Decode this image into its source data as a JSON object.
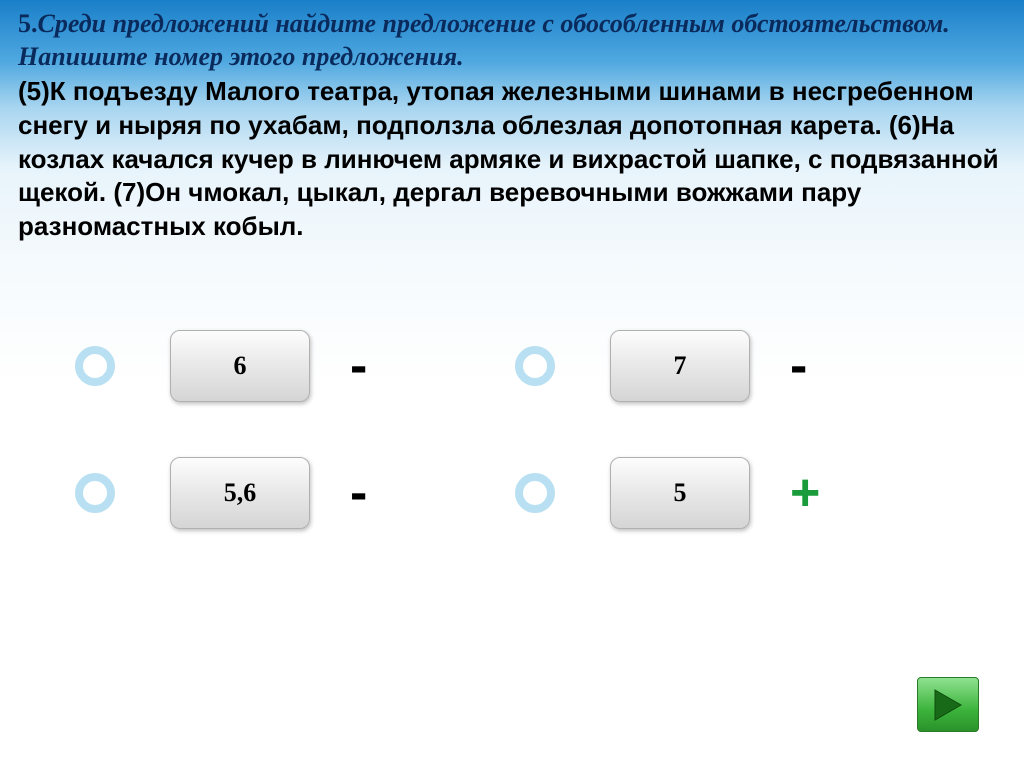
{
  "question": {
    "number": "5.",
    "prompt": "Среди предложений найдите предложение с обособленным обстоятельством. Напишите номер этого предложения.",
    "body": "(5)К подъезду Малого театра, утопая железными шинами в несгребенном снегу и ныряя по ухабам, подползла облезлая допотопная карета. (6)На козлах качался кучер в линючем армяке и вихрастой шапке, с подвязанной щекой. (7)Он чмокал, цыкал, дергал веревочными вожжами пару разномастных кобыл."
  },
  "answers": {
    "a": {
      "label": "6",
      "mark": "-"
    },
    "b": {
      "label": "7",
      "mark": "-"
    },
    "c": {
      "label": "5,6",
      "mark": "-"
    },
    "d": {
      "label": "5",
      "mark": "+"
    }
  }
}
